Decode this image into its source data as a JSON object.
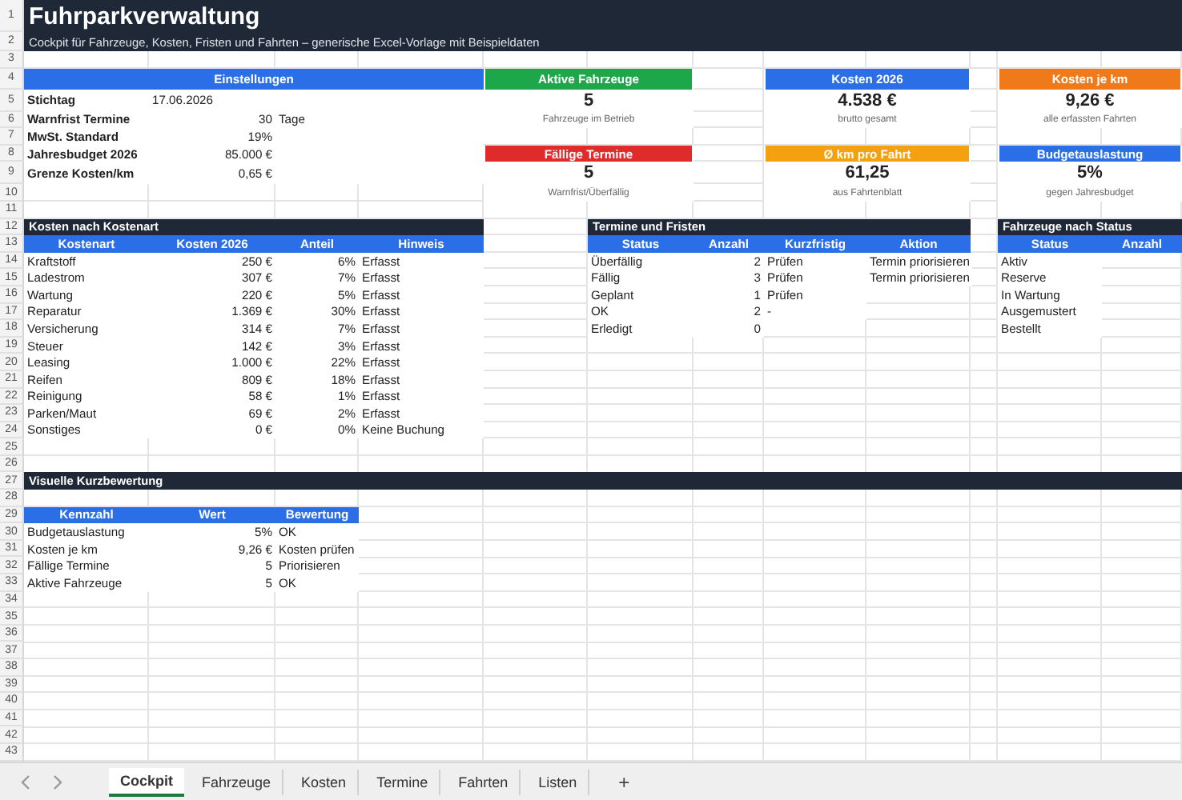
{
  "title": "Fuhrparkverwaltung",
  "subtitle": "Cockpit für Fahrzeuge, Kosten, Fristen und Fahrten – generische Excel-Vorlage mit Beispieldaten",
  "row_numbers": [
    "1",
    "2",
    "3",
    "4",
    "5",
    "6",
    "7",
    "8",
    "9",
    "10",
    "11",
    "12",
    "13",
    "14",
    "15",
    "16",
    "17",
    "18",
    "19",
    "20",
    "21",
    "22",
    "23",
    "24",
    "25",
    "26",
    "27",
    "28",
    "29",
    "30",
    "31",
    "32",
    "33",
    "34",
    "35",
    "36",
    "37",
    "38",
    "39",
    "40",
    "41",
    "42",
    "43"
  ],
  "settings": {
    "title": "Einstellungen",
    "rows": [
      {
        "label": "Stichtag",
        "value": "17.06.2026",
        "kind": "text"
      },
      {
        "label": "Warnfrist Termine",
        "value": "30",
        "unit": "Tage",
        "kind": "number"
      },
      {
        "label": "MwSt. Standard",
        "value": "19%",
        "kind": "number"
      },
      {
        "label": "Jahresbudget 2026",
        "value": "85.000 €",
        "kind": "number"
      },
      {
        "label": "Grenze Kosten/km",
        "value": "0,65 €",
        "kind": "number"
      }
    ]
  },
  "kpi_cards": [
    {
      "title": "Aktive Fahrzeuge",
      "value": "5",
      "caption": "Fahrzeuge im Betrieb",
      "color": "#1ea64b"
    },
    {
      "title": "Kosten 2026",
      "value": "4.538 €",
      "caption": "brutto gesamt",
      "color": "#2a6ee8"
    },
    {
      "title": "Kosten je km",
      "value": "9,26 €",
      "caption": "alle erfassten Fahrten",
      "color": "#f07a1a"
    },
    {
      "title": "Fällige Termine",
      "value": "5",
      "caption": "Warnfrist/Überfällig",
      "color": "#e02b2b"
    },
    {
      "title": "Ø km pro Fahrt",
      "value": "61,25",
      "caption": "aus Fahrtenblatt",
      "color": "#f5a00f"
    },
    {
      "title": "Budgetauslastung",
      "value": "5%",
      "caption": "gegen Jahresbudget",
      "color": "#2a6ee8"
    }
  ],
  "cost_table": {
    "title": "Kosten nach Kostenart",
    "columns": [
      "Kostenart",
      "Kosten 2026",
      "Anteil",
      "Hinweis"
    ],
    "rows": [
      [
        "Kraftstoff",
        "250 €",
        "6%",
        "Erfasst"
      ],
      [
        "Ladestrom",
        "307 €",
        "7%",
        "Erfasst"
      ],
      [
        "Wartung",
        "220 €",
        "5%",
        "Erfasst"
      ],
      [
        "Reparatur",
        "1.369 €",
        "30%",
        "Erfasst"
      ],
      [
        "Versicherung",
        "314 €",
        "7%",
        "Erfasst"
      ],
      [
        "Steuer",
        "142 €",
        "3%",
        "Erfasst"
      ],
      [
        "Leasing",
        "1.000 €",
        "22%",
        "Erfasst"
      ],
      [
        "Reifen",
        "809 €",
        "18%",
        "Erfasst"
      ],
      [
        "Reinigung",
        "58 €",
        "1%",
        "Erfasst"
      ],
      [
        "Parken/Maut",
        "69 €",
        "2%",
        "Erfasst"
      ],
      [
        "Sonstiges",
        "0 €",
        "0%",
        "Keine Buchung"
      ]
    ]
  },
  "deadlines": {
    "title": "Termine und Fristen",
    "columns": [
      "Status",
      "Anzahl",
      "Kurzfristig",
      "Aktion"
    ],
    "rows": [
      [
        "Überfällig",
        "2",
        "Prüfen",
        "Termin priorisieren"
      ],
      [
        "Fällig",
        "3",
        "Prüfen",
        "Termin priorisieren"
      ],
      [
        "Geplant",
        "1",
        "Prüfen"
      ],
      [
        "OK",
        "2",
        "-"
      ],
      [
        "Erledigt",
        "0"
      ]
    ]
  },
  "vehicle_status": {
    "title": "Fahrzeuge nach Status",
    "columns": [
      "Status",
      "Anzahl"
    ],
    "rows": [
      [
        "Aktiv"
      ],
      [
        "Reserve"
      ],
      [
        "In Wartung"
      ],
      [
        "Ausgemustert"
      ],
      [
        "Bestellt"
      ]
    ]
  },
  "assessment": {
    "title": "Visuelle Kurzbewertung",
    "columns": [
      "Kennzahl",
      "Wert",
      "Bewertung"
    ],
    "rows": [
      [
        "Budgetauslastung",
        "5%",
        "OK"
      ],
      [
        "Kosten je km",
        "9,26 €",
        "Kosten prüfen"
      ],
      [
        "Fällige Termine",
        "5",
        "Priorisieren"
      ],
      [
        "Aktive Fahrzeuge",
        "5",
        "OK"
      ]
    ]
  },
  "sheet_tabs": [
    {
      "label": "Cockpit",
      "selected": true
    },
    {
      "label": "Fahrzeuge",
      "selected": false
    },
    {
      "label": "Kosten",
      "selected": false
    },
    {
      "label": "Termine",
      "selected": false
    },
    {
      "label": "Fahrten",
      "selected": false
    },
    {
      "label": "Listen",
      "selected": false
    }
  ],
  "add_sheet": "+"
}
